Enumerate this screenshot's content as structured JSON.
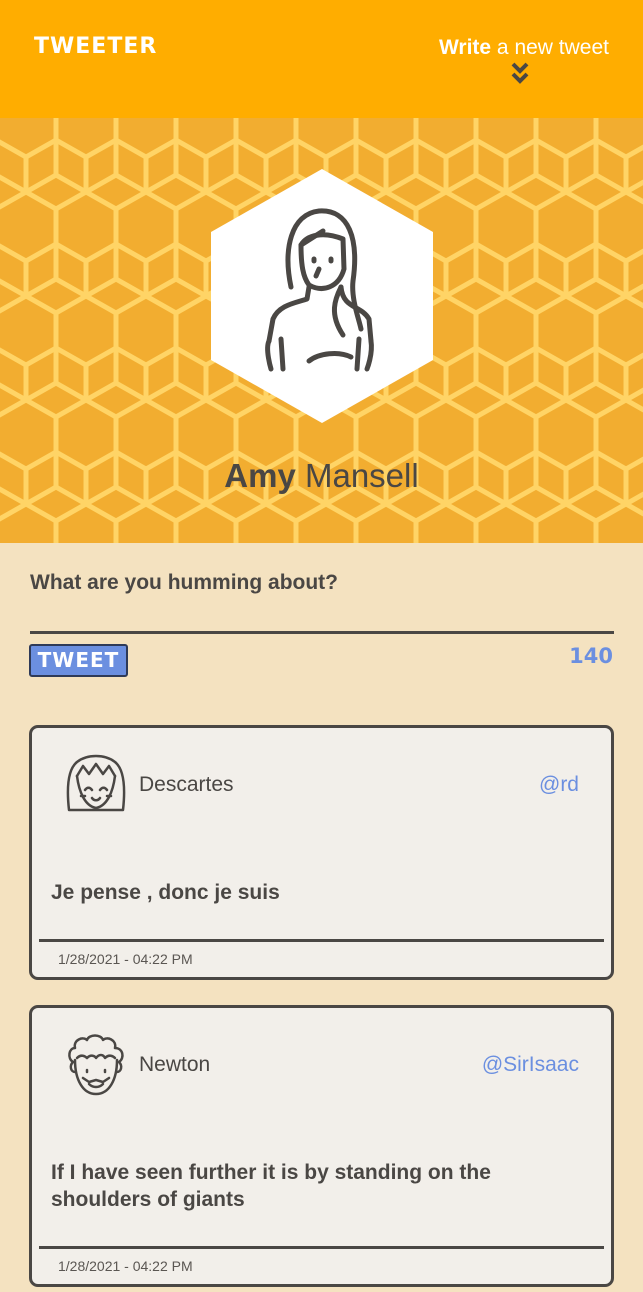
{
  "nav": {
    "brand": "TWEETER",
    "write_bold": "Write",
    "write_rest": " a new tweet"
  },
  "profile": {
    "first_name": "Amy",
    "last_name": "Mansell"
  },
  "compose": {
    "label": "What are you humming about?",
    "value": "",
    "button_label": "TWEET",
    "counter": "140"
  },
  "tweets": [
    {
      "author": "Descartes",
      "handle": "@rd",
      "content": "Je pense , donc je suis",
      "timestamp": "1/28/2021 - 04:22 PM",
      "avatar_icon": "girl-face-icon"
    },
    {
      "author": "Newton",
      "handle": "@SirIsaac",
      "content": "If I have seen further it is by standing on the shoulders of giants",
      "timestamp": "1/28/2021 - 04:22 PM",
      "avatar_icon": "curly-hair-face-icon"
    }
  ],
  "colors": {
    "nav": "#ffad00",
    "header": "#f2ad30",
    "accent": "#6b8fe0",
    "background": "#f4e2c0",
    "text": "#4a4744"
  }
}
